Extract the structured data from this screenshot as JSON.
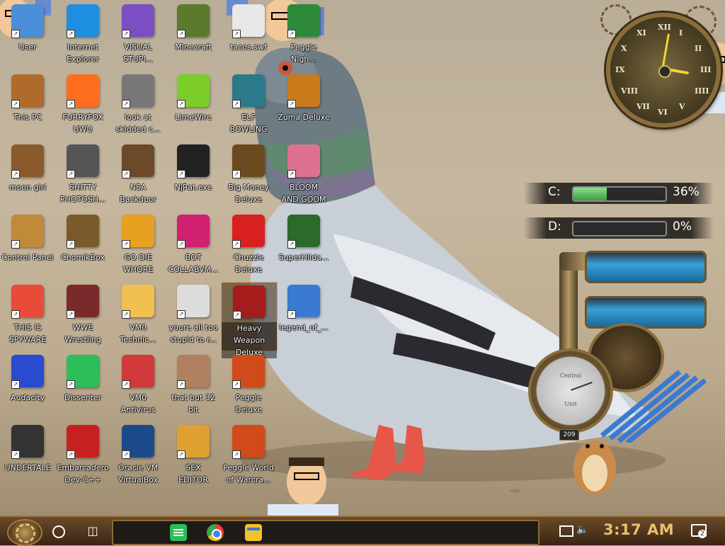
{
  "desktop": {
    "icons": [
      {
        "label": "User"
      },
      {
        "label": "Internet\nExplorer"
      },
      {
        "label": "VISUAL\nSTUPI..."
      },
      {
        "label": "Minecraft"
      },
      {
        "label": "tacos.swf"
      },
      {
        "label": "Peggle\nNigh..."
      },
      {
        "label": "This PC"
      },
      {
        "label": "FURRYFOX\nUWU"
      },
      {
        "label": "look at\nskidded c..."
      },
      {
        "label": "LimeWire"
      },
      {
        "label": "ELF\nBOWLING"
      },
      {
        "label": "Zuma Deluxe"
      },
      {
        "label": "moon girl"
      },
      {
        "label": "SHITTY\nPHOTOSH..."
      },
      {
        "label": "NSA\nBackdoor"
      },
      {
        "label": "NjRat.exe"
      },
      {
        "label": "Big Money\nDeluxe"
      },
      {
        "label": "BLOOM\nAND GOOM"
      },
      {
        "label": "Control Panel"
      },
      {
        "label": "ChomikBox"
      },
      {
        "label": "GO DIE\nWHORE"
      },
      {
        "label": "BOT\nCOLLABVM..."
      },
      {
        "label": "Chuzzle\nDeluxe"
      },
      {
        "label": "SuperHilda..."
      },
      {
        "label": "THIS IS\nSPYWARE"
      },
      {
        "label": "WWE\nWrestling"
      },
      {
        "label": "VM0\nTechnic..."
      },
      {
        "label": "youre all too\nstupid to r..."
      },
      {
        "label": "Heavy\nWeapon\nDeluxe"
      },
      {
        "label": "legend_of_..."
      },
      {
        "label": "Audacity"
      },
      {
        "label": "Dissenter"
      },
      {
        "label": "VM0\nAntivirus"
      },
      {
        "label": "that but 32\nbit"
      },
      {
        "label": "Peggle\nDeluxe"
      },
      {
        "label": "UNDERTALE"
      },
      {
        "label": "Embarcadero\nDev-C++"
      },
      {
        "label": "Oracle VM\nVirtualBox"
      },
      {
        "label": "SEX\nEDITOR"
      },
      {
        "label": "Peggle World\nof Warcra..."
      }
    ],
    "icon_colors": [
      "#4a8fd8",
      "#1e8fe0",
      "#7b4fc2",
      "#5a7b2e",
      "#e8e8e8",
      "#2e8a3a",
      "#b06a2c",
      "#ff6d1f",
      "#777777",
      "#7ccd2a",
      "#2a7a8c",
      "#c97a1a",
      "#8a5a2a",
      "#555555",
      "#6b4a2a",
      "#222222",
      "#6b4a1e",
      "#e07090",
      "#c08a3a",
      "#7a5a2a",
      "#e8a020",
      "#d02070",
      "#d82020",
      "#2a6a2a",
      "#e84b3a",
      "#7a2a2a",
      "#f0c050",
      "#dddddd",
      "#a51c1c",
      "#3a7ad0",
      "#2a4ad0",
      "#2dbd5a",
      "#d03a3a",
      "#b08060",
      "#d04a1a",
      "#333333",
      "#c82020",
      "#1a4a8a",
      "#e0a030",
      "#d04a1a"
    ]
  },
  "drives": [
    {
      "letter": "C:",
      "percent_text": "36%",
      "fill": 0.36
    },
    {
      "letter": "D:",
      "percent_text": "0%",
      "fill": 0.0
    }
  ],
  "clock": {
    "numerals": [
      "XII",
      "I",
      "II",
      "III",
      "IIII",
      "V",
      "VI",
      "VII",
      "VIII",
      "IX",
      "X",
      "XI"
    ]
  },
  "gauge": {
    "top_label": "Central",
    "bottom_label": "Unit",
    "counter": "209"
  },
  "taskbar": {
    "time": "3:17 AM",
    "notification_count": "2"
  }
}
